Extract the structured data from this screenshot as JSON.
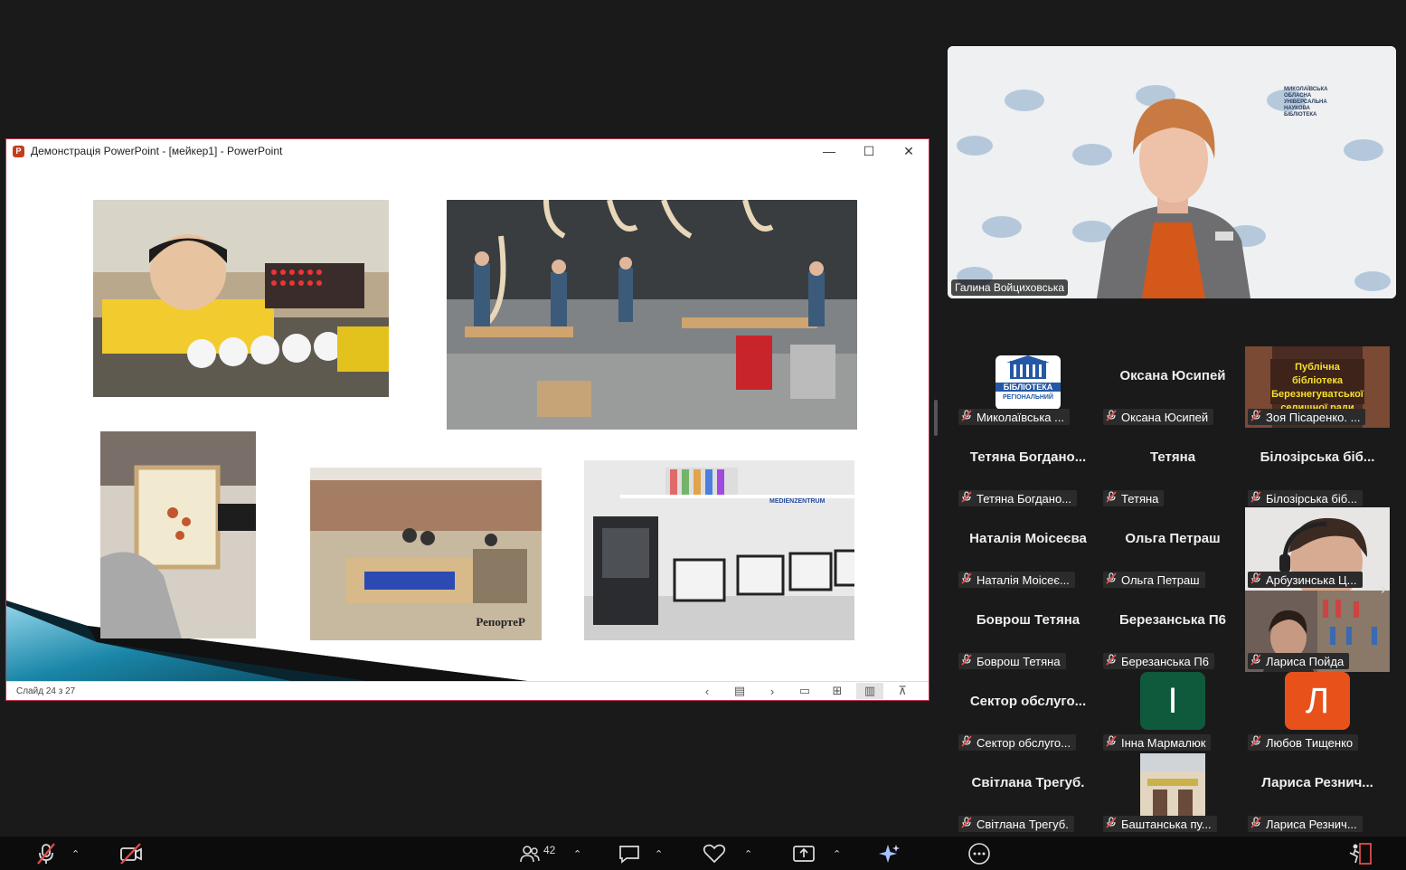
{
  "ppt": {
    "title": "Демонстрація PowerPoint - [мейкер1] - PowerPoint",
    "logo_letter": "P",
    "controls": {
      "minimize": "—",
      "maximize": "☐",
      "close": "✕"
    },
    "status": "Слайд 24 з 27",
    "photo_labels": {
      "medienzentrum": "MEDIENZENTRUM",
      "reporter": "РепортеР"
    }
  },
  "speaker": {
    "name": "Галина Войциховська",
    "backdrop_text": "МИКОЛАЇВСЬКА ОБЛАСНА УНІВЕРСАЛЬНА НАУКОВА БІБЛІОТЕКА"
  },
  "participants": [
    {
      "big": "",
      "label": "Миколаївська ...",
      "type": "logo",
      "logo_text": "БІБЛІОТЕКА",
      "logo_sub": "РЕГІОНАЛЬНИЙ"
    },
    {
      "big": "Оксана Юсипей",
      "label": "Оксана Юсипей",
      "type": "name"
    },
    {
      "big": "",
      "label": "Зоя Пісаренко. ...",
      "type": "banner",
      "banner_text": "Публічна бібліотека Березнегуватської селищної ради"
    },
    {
      "big": "Тетяна  Богдано...",
      "label": "Тетяна Богдано...",
      "type": "name"
    },
    {
      "big": "Тетяна",
      "label": "Тетяна",
      "type": "name"
    },
    {
      "big": "Білозірська  біб...",
      "label": "Білозірська біб...",
      "type": "name"
    },
    {
      "big": "Наталія Моісеєва",
      "label": "Наталія Моісеє...",
      "type": "name"
    },
    {
      "big": "Ольга Петраш",
      "label": "Ольга Петраш",
      "type": "name"
    },
    {
      "big": "",
      "label": "Арбузинська Ц...",
      "type": "video1"
    },
    {
      "big": "Боврош Тетяна",
      "label": "Боврош Тетяна",
      "type": "name"
    },
    {
      "big": "Березанська П6",
      "label": "Березанська П6",
      "type": "name"
    },
    {
      "big": "",
      "label": "Лариса Пойда",
      "type": "video2"
    },
    {
      "big": "Сектор  обслуго...",
      "label": "Сектор обслуго...",
      "type": "name"
    },
    {
      "big": "",
      "label": "Інна Мармалюк",
      "type": "avatar",
      "letter": "І",
      "color": "#0f5a3c"
    },
    {
      "big": "",
      "label": "Любов Тищенко",
      "type": "avatar",
      "letter": "Л",
      "color": "#e8521a"
    },
    {
      "big": "Світлана Трегуб.",
      "label": "Світлана Трегуб.",
      "type": "name"
    },
    {
      "big": "",
      "label": "Баштанська пу...",
      "type": "photo"
    },
    {
      "big": "Лариса  Резнич...",
      "label": "Лариса Резнич...",
      "type": "name"
    }
  ],
  "toolbar": {
    "participants_count": "42"
  },
  "colors": {
    "accent": "#c4314b",
    "bg": "#1a1a1a",
    "mic_off": "#e34b4b"
  }
}
